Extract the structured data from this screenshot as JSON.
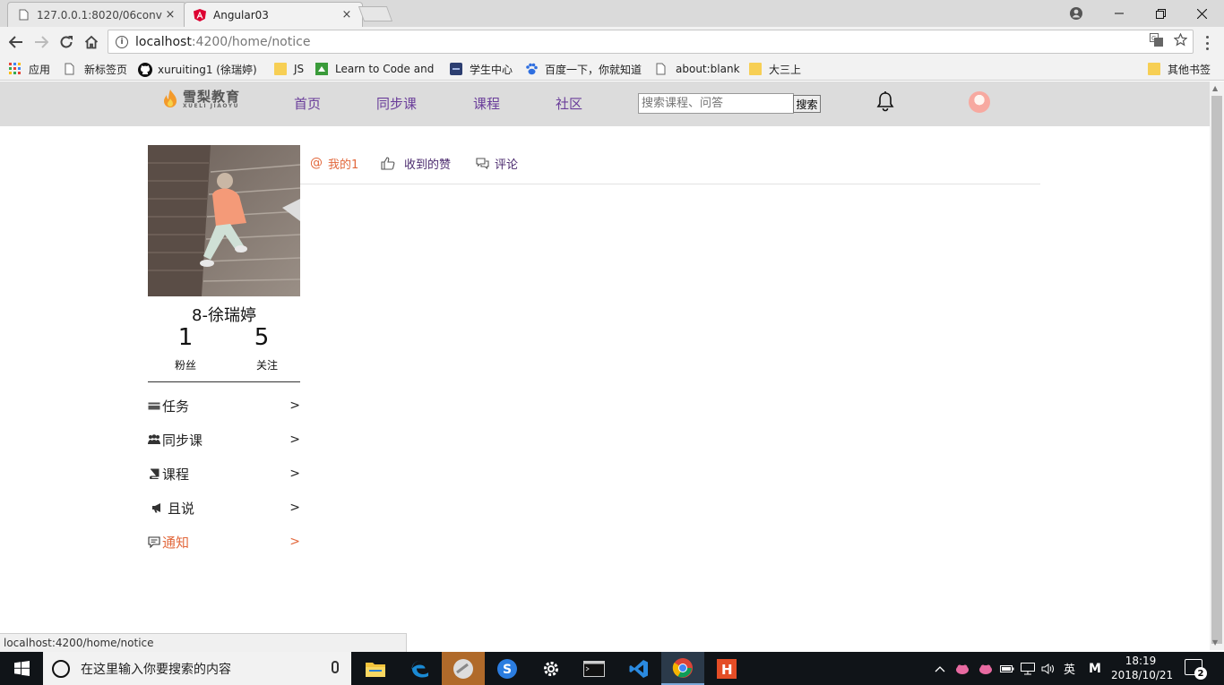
{
  "browser": {
    "tabs": [
      {
        "title": "127.0.0.1:8020/06conv",
        "close": "×"
      },
      {
        "title": "Angular03",
        "close": "×"
      }
    ],
    "url_host": "localhost",
    "url_path": ":4200/home/notice",
    "bookmarks": [
      {
        "label": "应用",
        "icon": "apps-grid-icon"
      },
      {
        "label": "新标签页",
        "icon": "page-icon"
      },
      {
        "label": "xuruiting1 (徐瑞婷)",
        "icon": "github-icon"
      },
      {
        "label": "JS",
        "icon": "folder-icon"
      },
      {
        "label": "Learn to Code and",
        "icon": "freecodecamp-icon"
      },
      {
        "label": "学生中心",
        "icon": "student-icon"
      },
      {
        "label": "百度一下，你就知道",
        "icon": "baidu-paw-icon"
      },
      {
        "label": "about:blank",
        "icon": "page-icon"
      },
      {
        "label": "大三上",
        "icon": "folder-icon"
      },
      {
        "label": "其他书签",
        "icon": "folder-icon"
      }
    ],
    "status_url": "localhost:4200/home/notice"
  },
  "site": {
    "logo_cn": "雪梨教育",
    "logo_en": "XUELI JIAOYU",
    "nav": [
      "首页",
      "同步课",
      "课程",
      "社区"
    ],
    "search_placeholder": "搜索课程、问答",
    "search_button": "搜索",
    "colors": {
      "nav": "#6a3d9a",
      "accent": "#e2683c",
      "header_bg": "#dcdcdc"
    }
  },
  "profile": {
    "name": "8-徐瑞婷",
    "fans_count": "1",
    "fans_label": "粉丝",
    "follow_count": "5",
    "follow_label": "关注"
  },
  "sidebar": {
    "items": [
      {
        "label": "任务",
        "icon": "card-icon",
        "arrow": ">"
      },
      {
        "label": "同步课",
        "icon": "users-icon",
        "arrow": ">"
      },
      {
        "label": "课程",
        "icon": "book-icon",
        "arrow": ">"
      },
      {
        "label": "且说",
        "icon": "bullhorn-icon",
        "arrow": ">"
      },
      {
        "label": "通知",
        "icon": "comment-icon",
        "arrow": ">",
        "active": true
      }
    ]
  },
  "notice_tabs": [
    {
      "label": "我的1",
      "icon": "at-icon",
      "active": true
    },
    {
      "label": "收到的赞",
      "icon": "thumbs-up-icon"
    },
    {
      "label": "评论",
      "icon": "comments-icon"
    }
  ],
  "taskbar": {
    "search_placeholder": "在这里输入你要搜索的内容",
    "ime": "英",
    "ime_mode": "M",
    "time": "18:19",
    "date": "2018/10/21",
    "notifications": "2"
  }
}
